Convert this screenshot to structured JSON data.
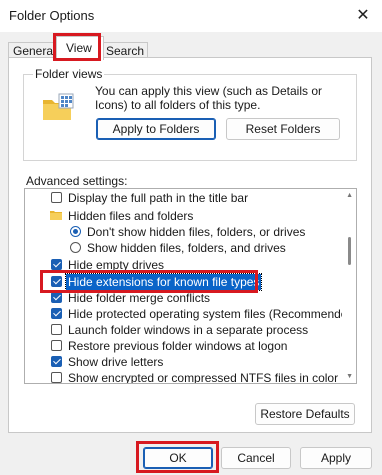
{
  "window": {
    "title": "Folder Options",
    "close_icon": "close-icon"
  },
  "tabs": [
    {
      "label": "General",
      "active": false
    },
    {
      "label": "View",
      "active": true
    },
    {
      "label": "Search",
      "active": false
    }
  ],
  "folder_views": {
    "group_label": "Folder views",
    "description": "You can apply this view (such as Details or Icons) to all folders of this type.",
    "apply_button": "Apply to Folders",
    "reset_button": "Reset Folders"
  },
  "advanced": {
    "label": "Advanced settings:",
    "items": [
      {
        "type": "checkbox",
        "checked": false,
        "indent": 1,
        "label": "Display the full path in the title bar"
      },
      {
        "type": "folder",
        "indent": 1,
        "label": "Hidden files and folders"
      },
      {
        "type": "radio",
        "checked": true,
        "indent": 2,
        "label": "Don't show hidden files, folders, or drives"
      },
      {
        "type": "radio",
        "checked": false,
        "indent": 2,
        "label": "Show hidden files, folders, and drives"
      },
      {
        "type": "checkbox",
        "checked": true,
        "indent": 1,
        "label": "Hide empty drives"
      },
      {
        "type": "checkbox",
        "checked": true,
        "indent": 1,
        "label": "Hide extensions for known file types",
        "selected": true
      },
      {
        "type": "checkbox",
        "checked": true,
        "indent": 1,
        "label": "Hide folder merge conflicts"
      },
      {
        "type": "checkbox",
        "checked": true,
        "indent": 1,
        "label": "Hide protected operating system files (Recommended)"
      },
      {
        "type": "checkbox",
        "checked": false,
        "indent": 1,
        "label": "Launch folder windows in a separate process"
      },
      {
        "type": "checkbox",
        "checked": false,
        "indent": 1,
        "label": "Restore previous folder windows at logon"
      },
      {
        "type": "checkbox",
        "checked": true,
        "indent": 1,
        "label": "Show drive letters"
      },
      {
        "type": "checkbox",
        "checked": false,
        "indent": 1,
        "label": "Show encrypted or compressed NTFS files in color"
      }
    ],
    "restore_defaults_button": "Restore Defaults"
  },
  "footer": {
    "ok": "OK",
    "cancel": "Cancel",
    "apply": "Apply"
  },
  "colors": {
    "accent": "#1a5fb4",
    "highlight": "#d71920",
    "selection": "#0a64c8"
  }
}
